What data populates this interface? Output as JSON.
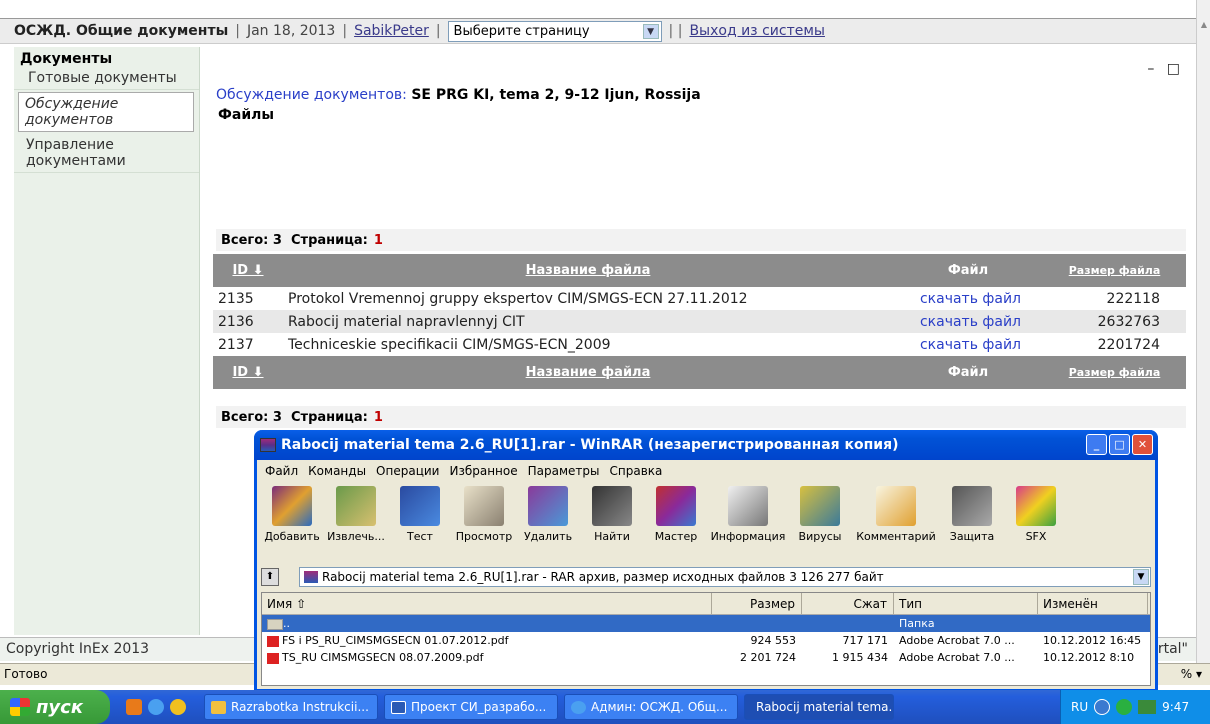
{
  "header": {
    "app_title": "ОСЖД. Общие документы",
    "date": "Jan 18, 2013",
    "user": "SabikPeter",
    "page_select": "Выберите страницу",
    "logout": "Выход из системы"
  },
  "sidebar": {
    "title": "Документы",
    "items": [
      "Готовые документы",
      "Обсуждение документов",
      "Управление документами"
    ]
  },
  "main": {
    "window_controls": "– □",
    "discussion_label": "Обсуждение документов:",
    "discussion_title": "SE PRG KI, tema 2, 9-12 Ijun, Rossija",
    "files_label": "Файлы",
    "total_label": "Всего: 3",
    "page_label": "Страница:",
    "page_number": "1",
    "columns": [
      "ID ⬇",
      "Название файла",
      "Файл",
      "Размер файла"
    ],
    "rows": [
      {
        "id": "2135",
        "name": "Protokol Vremennoj gruppy ekspertov CIM/SMGS-ECN 27.11.2012",
        "link": "скачать файл",
        "size": "222118"
      },
      {
        "id": "2136",
        "name": "Rabocij material napravlennyj CIT",
        "link": "скачать файл",
        "size": "2632763"
      },
      {
        "id": "2137",
        "name": "Techniceskie specifikacii CIM/SMGS-ECN_2009",
        "link": "скачать файл",
        "size": "2201724"
      }
    ]
  },
  "footer": {
    "copyright": "Copyright InEx 2013",
    "right_fragment": "rtal\""
  },
  "statusbar": {
    "text": "Готово",
    "right": "%  ▾"
  },
  "winrar": {
    "title": "Rabocij material tema 2.6_RU[1].rar - WinRAR (незарегистрированная копия)",
    "menu": [
      "Файл",
      "Команды",
      "Операции",
      "Избранное",
      "Параметры",
      "Справка"
    ],
    "tools": [
      "Добавить",
      "Извлечь...",
      "Тест",
      "Просмотр",
      "Удалить",
      "Найти",
      "Мастер",
      "Информация",
      "Вирусы",
      "Комментарий",
      "Защита",
      "SFX"
    ],
    "path": "Rabocij material tema 2.6_RU[1].rar - RAR архив, размер исходных файлов 3 126 277 байт",
    "columns": [
      "Имя  ⇧",
      "Размер",
      "Сжат",
      "Тип",
      "Изменён"
    ],
    "files": [
      {
        "name": "..",
        "size": "",
        "packed": "",
        "type": "Папка",
        "modified": ""
      },
      {
        "name": "FS i PS_RU_CIMSMGSECN 01.07.2012.pdf",
        "size": "924 553",
        "packed": "717 171",
        "type": "Adobe Acrobat 7.0 ...",
        "modified": "10.12.2012 16:45"
      },
      {
        "name": "TS_RU CIMSMGSECN 08.07.2009.pdf",
        "size": "2 201 724",
        "packed": "1 915 434",
        "type": "Adobe Acrobat 7.0 ...",
        "modified": "10.12.2012 8:10"
      }
    ]
  },
  "taskbar": {
    "start": "пуск",
    "items": [
      "Razrabotka Instrukcii...",
      "Проект СИ_разрабо...",
      "Админ: ОСЖД. Общ...",
      "Rabocij material tema..."
    ],
    "lang": "RU",
    "time": "9:47"
  },
  "colors": {
    "accent_blue": "#2a3fc8",
    "page_red": "#c00000",
    "sidebar_bg": "#eaf1e9",
    "table_header": "#8c8c8c"
  }
}
